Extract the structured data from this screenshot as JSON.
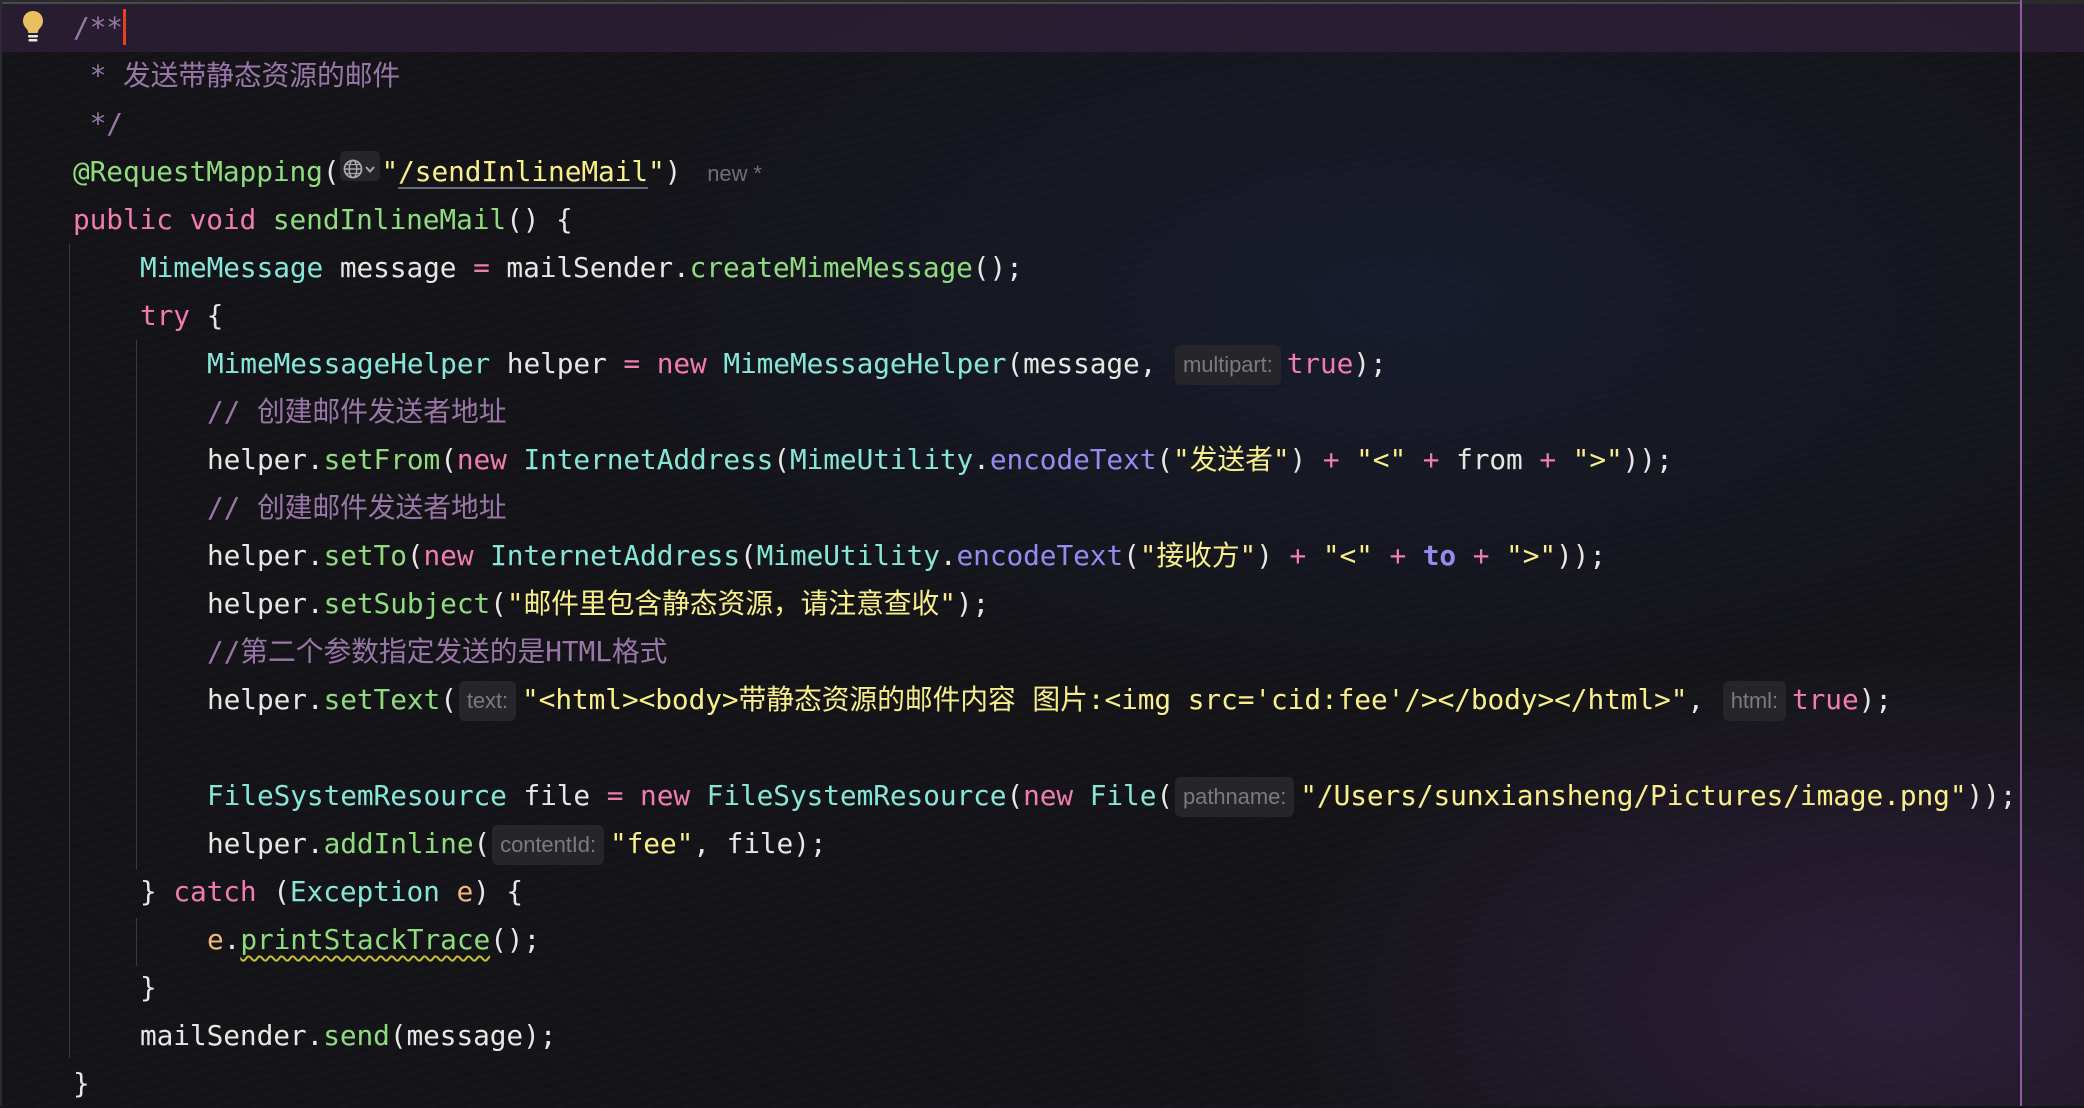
{
  "editor": {
    "language": "java",
    "colors": {
      "background": "#141418",
      "current_line": "#231c2b",
      "caret": "#e8401c",
      "margin_line": "#8c5c9c",
      "comment": "#9a76a8",
      "annotation": "#8fdc7e",
      "keyword": "#f07cb0",
      "type": "#86e6d8",
      "method": "#8fdc7e",
      "string": "#f8ee8a",
      "static_method": "#958cf0",
      "field": "#958cf0",
      "parameter": "#f2b67a"
    },
    "gutter": {
      "intention_icon": "lightbulb-icon"
    },
    "inlay_new_label": "new *",
    "lines": [
      {
        "indent": 0,
        "tokens": [
          [
            "com",
            "/**"
          ],
          [
            "caret",
            ""
          ]
        ]
      },
      {
        "indent": 0,
        "tokens": [
          [
            "com",
            " * 发送带静态资源的邮件"
          ]
        ]
      },
      {
        "indent": 0,
        "tokens": [
          [
            "com",
            " */"
          ]
        ]
      },
      {
        "indent": 0,
        "tokens": [
          [
            "ann",
            "@RequestMapping"
          ],
          [
            "plain",
            "("
          ],
          [
            "globe",
            ""
          ],
          [
            "str",
            "\""
          ],
          [
            "url",
            "/sendInlineMail"
          ],
          [
            "str",
            "\""
          ],
          [
            "plain",
            ")"
          ],
          [
            "newhint",
            "new *"
          ]
        ]
      },
      {
        "indent": 0,
        "tokens": [
          [
            "kw",
            "public"
          ],
          [
            "plain",
            " "
          ],
          [
            "kw",
            "void"
          ],
          [
            "plain",
            " "
          ],
          [
            "fn",
            "sendInlineMail"
          ],
          [
            "plain",
            "() {"
          ]
        ]
      },
      {
        "indent": 1,
        "tokens": [
          [
            "type",
            "MimeMessage"
          ],
          [
            "plain",
            " message "
          ],
          [
            "op",
            "="
          ],
          [
            "plain",
            " mailSender."
          ],
          [
            "fn",
            "createMimeMessage"
          ],
          [
            "plain",
            "();"
          ]
        ]
      },
      {
        "indent": 1,
        "tokens": [
          [
            "kw",
            "try"
          ],
          [
            "plain",
            " {"
          ]
        ]
      },
      {
        "indent": 2,
        "tokens": [
          [
            "type",
            "MimeMessageHelper"
          ],
          [
            "plain",
            " helper "
          ],
          [
            "op",
            "="
          ],
          [
            "plain",
            " "
          ],
          [
            "kw",
            "new"
          ],
          [
            "plain",
            " "
          ],
          [
            "type",
            "MimeMessageHelper"
          ],
          [
            "plain",
            "(message, "
          ],
          [
            "hint",
            "multipart:"
          ],
          [
            "kw",
            "true"
          ],
          [
            "plain",
            ");"
          ]
        ]
      },
      {
        "indent": 2,
        "tokens": [
          [
            "com",
            "// 创建邮件发送者地址"
          ]
        ]
      },
      {
        "indent": 2,
        "tokens": [
          [
            "plain",
            "helper."
          ],
          [
            "fn",
            "setFrom"
          ],
          [
            "plain",
            "("
          ],
          [
            "kw",
            "new"
          ],
          [
            "plain",
            " "
          ],
          [
            "type",
            "InternetAddress"
          ],
          [
            "plain",
            "("
          ],
          [
            "type",
            "MimeUtility"
          ],
          [
            "plain",
            "."
          ],
          [
            "static",
            "encodeText"
          ],
          [
            "plain",
            "("
          ],
          [
            "str",
            "\"发送者\""
          ],
          [
            "plain",
            ") "
          ],
          [
            "op",
            "+"
          ],
          [
            "plain",
            " "
          ],
          [
            "str",
            "\"<\""
          ],
          [
            "plain",
            " "
          ],
          [
            "op",
            "+"
          ],
          [
            "plain",
            " from "
          ],
          [
            "op",
            "+"
          ],
          [
            "plain",
            " "
          ],
          [
            "str",
            "\">\""
          ],
          [
            "plain",
            "));"
          ]
        ]
      },
      {
        "indent": 2,
        "tokens": [
          [
            "com",
            "// 创建邮件发送者地址"
          ]
        ]
      },
      {
        "indent": 2,
        "tokens": [
          [
            "plain",
            "helper."
          ],
          [
            "fn",
            "setTo"
          ],
          [
            "plain",
            "("
          ],
          [
            "kw",
            "new"
          ],
          [
            "plain",
            " "
          ],
          [
            "type",
            "InternetAddress"
          ],
          [
            "plain",
            "("
          ],
          [
            "type",
            "MimeUtility"
          ],
          [
            "plain",
            "."
          ],
          [
            "static",
            "encodeText"
          ],
          [
            "plain",
            "("
          ],
          [
            "str",
            "\"接收方\""
          ],
          [
            "plain",
            ") "
          ],
          [
            "op",
            "+"
          ],
          [
            "plain",
            " "
          ],
          [
            "str",
            "\"<\""
          ],
          [
            "plain",
            " "
          ],
          [
            "op",
            "+"
          ],
          [
            "plain",
            " "
          ],
          [
            "field",
            "to"
          ],
          [
            "plain",
            " "
          ],
          [
            "op",
            "+"
          ],
          [
            "plain",
            " "
          ],
          [
            "str",
            "\">\""
          ],
          [
            "plain",
            "));"
          ]
        ]
      },
      {
        "indent": 2,
        "tokens": [
          [
            "plain",
            "helper."
          ],
          [
            "fn",
            "setSubject"
          ],
          [
            "plain",
            "("
          ],
          [
            "str",
            "\"邮件里包含静态资源，请注意查收\""
          ],
          [
            "plain",
            ");"
          ]
        ]
      },
      {
        "indent": 2,
        "tokens": [
          [
            "com",
            "//第二个参数指定发送的是HTML格式"
          ]
        ]
      },
      {
        "indent": 2,
        "tokens": [
          [
            "plain",
            "helper."
          ],
          [
            "fn",
            "setText"
          ],
          [
            "plain",
            "("
          ],
          [
            "hint",
            "text:"
          ],
          [
            "str",
            "\"<html><body>带静态资源的邮件内容 图片:<img src='cid:fee'/></body></html>\""
          ],
          [
            "plain",
            ", "
          ],
          [
            "hint",
            "html:"
          ],
          [
            "kw",
            "true"
          ],
          [
            "plain",
            ");"
          ]
        ]
      },
      {
        "indent": 2,
        "tokens": []
      },
      {
        "indent": 2,
        "tokens": [
          [
            "type",
            "FileSystemResource"
          ],
          [
            "plain",
            " file "
          ],
          [
            "op",
            "="
          ],
          [
            "plain",
            " "
          ],
          [
            "kw",
            "new"
          ],
          [
            "plain",
            " "
          ],
          [
            "type",
            "FileSystemResource"
          ],
          [
            "plain",
            "("
          ],
          [
            "kw",
            "new"
          ],
          [
            "plain",
            " "
          ],
          [
            "type",
            "File"
          ],
          [
            "plain",
            "("
          ],
          [
            "hint",
            "pathname:"
          ],
          [
            "str",
            "\"/Users/sunxiansheng/Pictures/image.png\""
          ],
          [
            "plain",
            "));"
          ]
        ]
      },
      {
        "indent": 2,
        "tokens": [
          [
            "plain",
            "helper."
          ],
          [
            "fn",
            "addInline"
          ],
          [
            "plain",
            "("
          ],
          [
            "hint",
            "contentId:"
          ],
          [
            "str",
            "\"fee\""
          ],
          [
            "plain",
            ", file);"
          ]
        ]
      },
      {
        "indent": 1,
        "tokens": [
          [
            "plain",
            "} "
          ],
          [
            "kw",
            "catch"
          ],
          [
            "plain",
            " ("
          ],
          [
            "type",
            "Exception"
          ],
          [
            "plain",
            " "
          ],
          [
            "param",
            "e"
          ],
          [
            "plain",
            ") {"
          ]
        ]
      },
      {
        "indent": 2,
        "tokens": [
          [
            "param",
            "e"
          ],
          [
            "plain",
            "."
          ],
          [
            "warn",
            "printStackTrace"
          ],
          [
            "plain",
            "();"
          ]
        ]
      },
      {
        "indent": 1,
        "tokens": [
          [
            "plain",
            "}"
          ]
        ]
      },
      {
        "indent": 1,
        "tokens": [
          [
            "plain",
            "mailSender."
          ],
          [
            "fn",
            "send"
          ],
          [
            "plain",
            "(message);"
          ]
        ]
      },
      {
        "indent": 0,
        "tokens": [
          [
            "plain",
            "}"
          ]
        ]
      }
    ]
  }
}
